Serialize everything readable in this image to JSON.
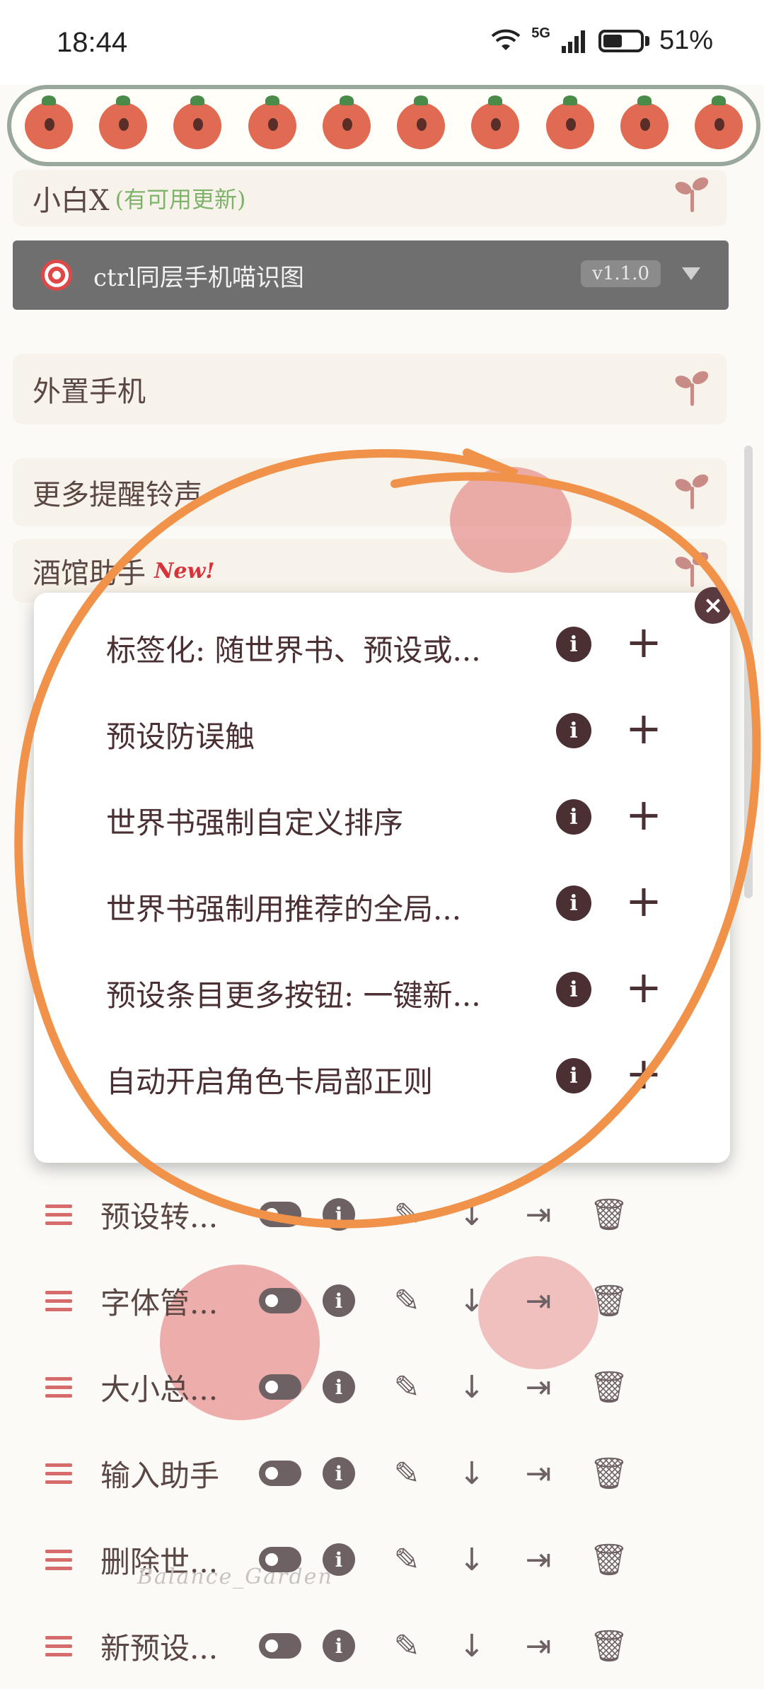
{
  "status_bar": {
    "time": "18:44",
    "network": "5G",
    "battery": "51%"
  },
  "panels": {
    "xiaobai": {
      "title": "小白X",
      "note": "(有可用更新)"
    },
    "script_bar": {
      "name": "ctrl同层手机喵识图",
      "version": "v1.1.0"
    },
    "external_phone": {
      "title": "外置手机"
    },
    "more_reminders": {
      "title": "更多提醒铃声"
    },
    "tavern_helper": {
      "title": "酒馆助手",
      "badge": "New!"
    }
  },
  "modal": {
    "items": [
      {
        "label": "标签化: 随世界书、预设或..."
      },
      {
        "label": "预设防误触"
      },
      {
        "label": "世界书强制自定义排序"
      },
      {
        "label": "世界书强制用推荐的全局..."
      },
      {
        "label": "预设条目更多按钮: 一键新..."
      },
      {
        "label": "自动开启角色卡局部正则"
      }
    ],
    "info_glyph": "i",
    "add_glyph": "+",
    "close_glyph": "×"
  },
  "scripts": [
    {
      "label": "预设转..."
    },
    {
      "label": "字体管..."
    },
    {
      "label": "大小总..."
    },
    {
      "label": "输入助手"
    },
    {
      "label": "删除世..."
    },
    {
      "label": "新预设..."
    }
  ],
  "watermark": "Balance_Garden",
  "colors": {
    "accent_orange": "#f0924a",
    "brand_dark": "#4a2f33",
    "hamburger": "#d66b6b"
  }
}
